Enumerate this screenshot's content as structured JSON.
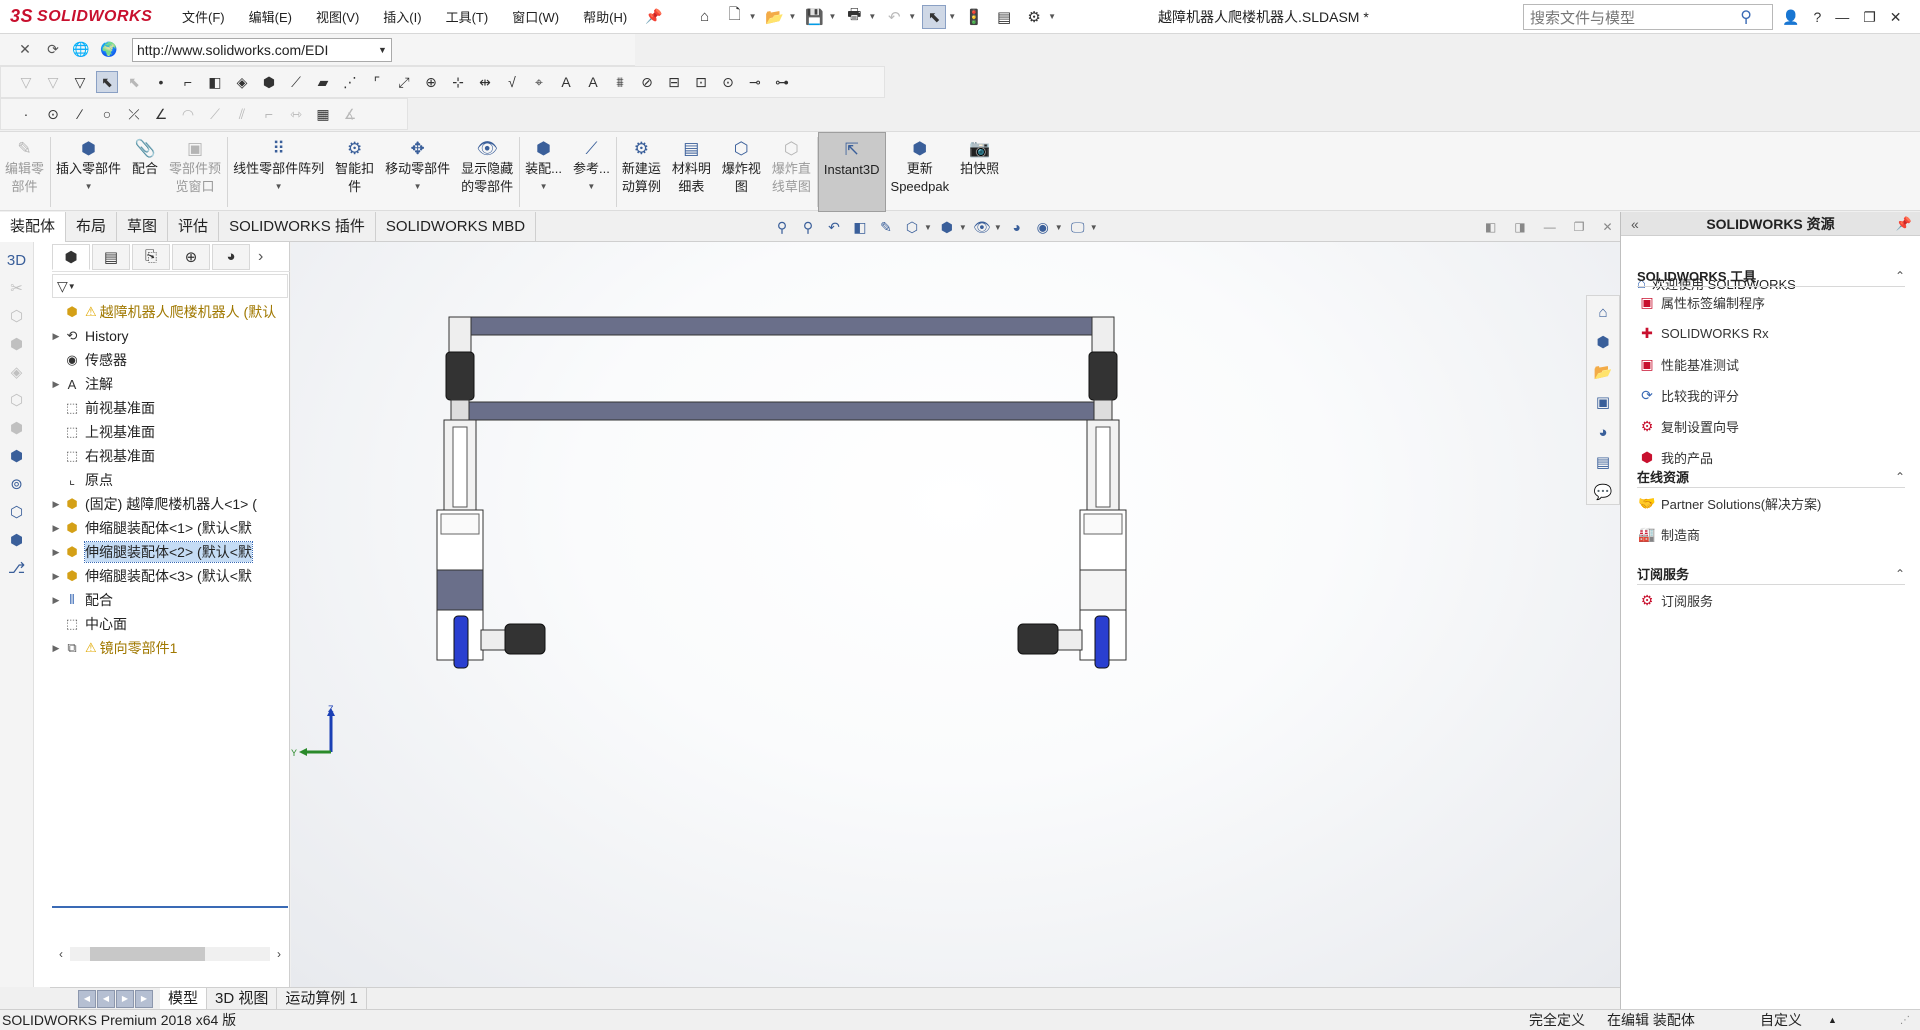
{
  "app": {
    "logo_text": "SOLIDWORKS",
    "document_title": "越障机器人爬楼机器人.SLDASM *",
    "search_placeholder": "搜索文件与模型"
  },
  "menus": [
    "文件(F)",
    "编辑(E)",
    "视图(V)",
    "插入(I)",
    "工具(T)",
    "窗口(W)",
    "帮助(H)"
  ],
  "url_bar": {
    "value": "http://www.solidworks.com/EDI"
  },
  "ribbon": [
    {
      "label": "编辑零\n部件",
      "icon": "edit-component-icon",
      "enabled": false
    },
    {
      "label": "插入零部件",
      "icon": "insert-component-icon",
      "enabled": true,
      "caret": true
    },
    {
      "label": "配合",
      "icon": "mate-icon",
      "enabled": true
    },
    {
      "label": "零部件预\n览窗口",
      "icon": "component-preview-icon",
      "enabled": false
    },
    {
      "label": "线性零部件阵列",
      "icon": "linear-pattern-icon",
      "enabled": true,
      "caret": true
    },
    {
      "label": "智能扣\n件",
      "icon": "smart-fasteners-icon",
      "enabled": true
    },
    {
      "label": "移动零部件",
      "icon": "move-component-icon",
      "enabled": true,
      "caret": true
    },
    {
      "label": "显示隐藏\n的零部件",
      "icon": "show-hidden-icon",
      "enabled": true
    },
    {
      "label": "装配...",
      "icon": "assembly-features-icon",
      "enabled": true,
      "caret": true
    },
    {
      "label": "参考...",
      "icon": "reference-geometry-icon",
      "enabled": true,
      "caret": true
    },
    {
      "label": "新建运\n动算例",
      "icon": "new-motion-study-icon",
      "enabled": true
    },
    {
      "label": "材料明\n细表",
      "icon": "bom-icon",
      "enabled": true
    },
    {
      "label": "爆炸视\n图",
      "icon": "exploded-view-icon",
      "enabled": true
    },
    {
      "label": "爆炸直\n线草图",
      "icon": "explode-line-sketch-icon",
      "enabled": false
    },
    {
      "label": "Instant3D",
      "icon": "instant3d-icon",
      "enabled": true,
      "active": true
    },
    {
      "label": "更新\nSpeedpak",
      "icon": "speedpak-icon",
      "enabled": true
    },
    {
      "label": "拍快照",
      "icon": "snapshot-icon",
      "enabled": true
    }
  ],
  "cm_tabs": [
    {
      "label": "装配体",
      "active": true
    },
    {
      "label": "布局"
    },
    {
      "label": "草图"
    },
    {
      "label": "评估"
    },
    {
      "label": "SOLIDWORKS 插件"
    },
    {
      "label": "SOLIDWORKS MBD"
    }
  ],
  "tree": [
    {
      "label": "越障机器人爬楼机器人  (默认",
      "icon": "assembly-icon",
      "warn": true,
      "expand": false,
      "level": 0
    },
    {
      "label": "History",
      "icon": "history-icon",
      "expand": true,
      "level": 1
    },
    {
      "label": "传感器",
      "icon": "sensor-icon",
      "expand": false,
      "level": 1
    },
    {
      "label": "注解",
      "icon": "annotation-icon",
      "expand": true,
      "level": 1
    },
    {
      "label": "前视基准面",
      "icon": "plane-icon",
      "expand": false,
      "level": 1
    },
    {
      "label": "上视基准面",
      "icon": "plane-icon",
      "expand": false,
      "level": 1
    },
    {
      "label": "右视基准面",
      "icon": "plane-icon",
      "expand": false,
      "level": 1
    },
    {
      "label": "原点",
      "icon": "origin-icon",
      "expand": false,
      "level": 1
    },
    {
      "label": "(固定) 越障爬楼机器人<1> (",
      "icon": "subassembly-icon",
      "expand": true,
      "level": 1
    },
    {
      "label": "伸缩腿装配体<1> (默认<默",
      "icon": "subassembly-icon",
      "expand": true,
      "level": 1
    },
    {
      "label": "伸缩腿装配体<2> (默认<默",
      "icon": "subassembly-icon",
      "expand": true,
      "level": 1,
      "selected": true
    },
    {
      "label": "伸缩腿装配体<3> (默认<默",
      "icon": "subassembly-icon",
      "expand": true,
      "level": 1
    },
    {
      "label": "配合",
      "icon": "mates-icon",
      "expand": true,
      "level": 1
    },
    {
      "label": "中心面",
      "icon": "plane-icon",
      "expand": false,
      "level": 1
    },
    {
      "label": "镜向零部件1",
      "icon": "mirror-component-icon",
      "expand": true,
      "level": 1,
      "warn": true
    }
  ],
  "bottom_tabs": [
    {
      "label": "模型",
      "active": true
    },
    {
      "label": "3D 视图"
    },
    {
      "label": "运动算例 1"
    }
  ],
  "status": {
    "left": "SOLIDWORKS Premium 2018 x64 版",
    "definition": "完全定义",
    "editing": "在编辑 装配体",
    "units": "自定义"
  },
  "taskpane": {
    "title": "SOLIDWORKS 资源",
    "welcome": "欢迎使用  SOLIDWORKS",
    "sections": [
      {
        "title": "SOLIDWORKS 工具",
        "items": [
          {
            "label": "属性标签编制程序",
            "icon": "property-tab-builder-icon"
          },
          {
            "label": "SOLIDWORKS Rx",
            "icon": "rx-icon"
          },
          {
            "label": "性能基准测试",
            "icon": "benchmark-icon"
          },
          {
            "label": "比较我的评分",
            "icon": "compare-score-icon",
            "blue": true
          },
          {
            "label": "复制设置向导",
            "icon": "copy-settings-icon"
          },
          {
            "label": "我的产品",
            "icon": "my-products-icon"
          }
        ]
      },
      {
        "title": "在线资源",
        "items": [
          {
            "label": "Partner Solutions(解决方案)",
            "icon": "handshake-icon",
            "gray": true
          },
          {
            "label": "制造商",
            "icon": "manufacturer-icon",
            "gray": true
          }
        ]
      },
      {
        "title": "订阅服务",
        "items": [
          {
            "label": "订阅服务",
            "icon": "subscription-icon"
          }
        ]
      }
    ]
  },
  "triad": {
    "y_label": "Y",
    "z_label": "Z"
  },
  "colors": {
    "brand": "#c8102e",
    "accent": "#3a6ab5",
    "frame_blue": "#6a6f8a",
    "wheel_blue": "#2a3fd0"
  }
}
